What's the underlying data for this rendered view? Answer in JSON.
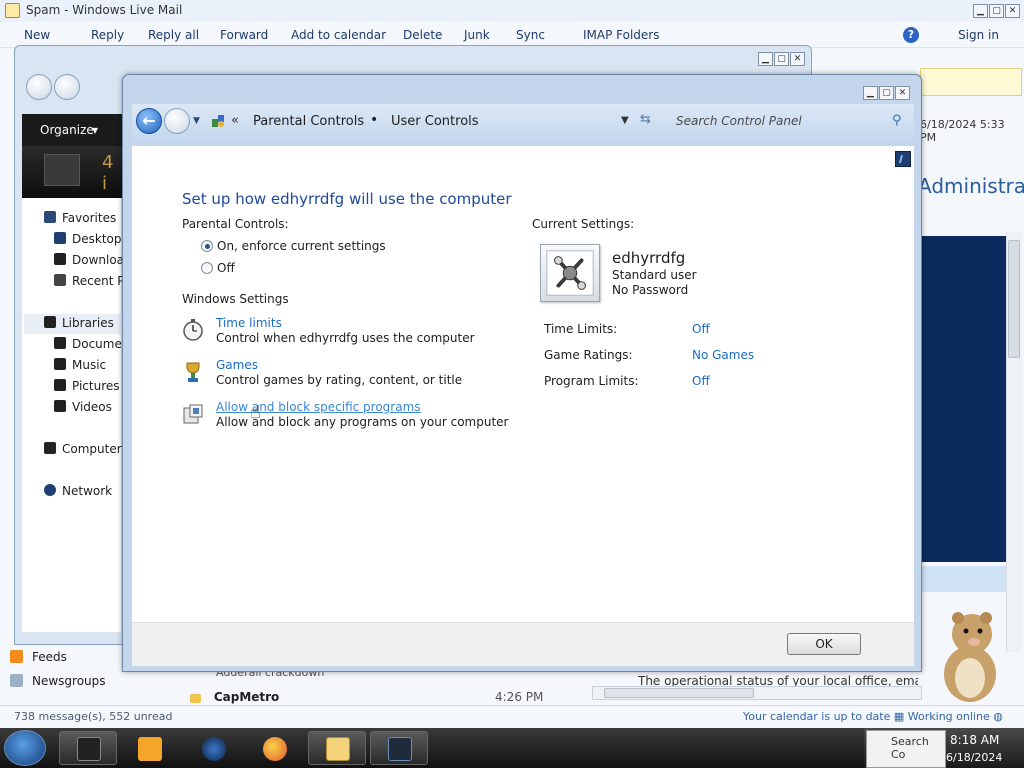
{
  "mail": {
    "title": "Spam - Windows Live Mail",
    "toolbar": [
      "New",
      "Reply",
      "Reply all",
      "Forward",
      "Add to calendar",
      "Delete",
      "Junk",
      "Sync",
      "IMAP Folders"
    ],
    "sign_in": "Sign in",
    "date_time": "6/18/2024 5:33 PM",
    "admin_heading": "Administra",
    "feeds": "Feeds",
    "newsgroups": "Newsgroups",
    "message_sender": "CapMetro",
    "message_time": "4:26 PM",
    "message_subject_partial": "Adderall crackdown",
    "preview_text": "The operational status of your local office, email",
    "status_left": "738 message(s), 552 unread",
    "status_calendar": "Your calendar is up to date",
    "status_online": "Working online"
  },
  "explorer": {
    "organize": "Organize",
    "count": "4 i",
    "items": {
      "favorites": "Favorites",
      "desktop": "Desktop",
      "downloads": "Download",
      "recent": "Recent Pl",
      "libraries": "Libraries",
      "documents": "Documer",
      "music": "Music",
      "pictures": "Pictures",
      "videos": "Videos",
      "computer": "Computer",
      "network": "Network"
    }
  },
  "parental": {
    "breadcrumb": [
      "Parental Controls",
      "User Controls"
    ],
    "search_placeholder": "Search Control Panel",
    "heading": "Set up how edhyrrdfg will use the computer",
    "parental_controls_label": "Parental Controls:",
    "option_on": "On, enforce current settings",
    "option_off": "Off",
    "selected_option": "on",
    "windows_settings_label": "Windows Settings",
    "settings": [
      {
        "link": "Time limits",
        "desc": "Control when edhyrrdfg uses the computer",
        "icon": "stopwatch-icon"
      },
      {
        "link": "Games",
        "desc": "Control games by rating, content, or title",
        "icon": "games-icon"
      },
      {
        "link": "Allow and block specific programs",
        "desc": "Allow and block any programs on your computer",
        "icon": "programs-icon"
      }
    ],
    "current_settings_label": "Current Settings:",
    "user_name": "edhyrrdfg",
    "user_type": "Standard user",
    "user_password": "No Password",
    "current": [
      {
        "key": "Time Limits:",
        "value": "Off"
      },
      {
        "key": "Game Ratings:",
        "value": "No Games"
      },
      {
        "key": "Program Limits:",
        "value": "Off"
      }
    ],
    "ok_label": "OK"
  },
  "taskbar": {
    "time": "8:18 AM",
    "date": "6/18/2024",
    "tray_text": "Search Co"
  },
  "colors": {
    "link": "#1a6bc4",
    "heading": "#1f4a9a",
    "taskbar": "#1a1a1a"
  }
}
